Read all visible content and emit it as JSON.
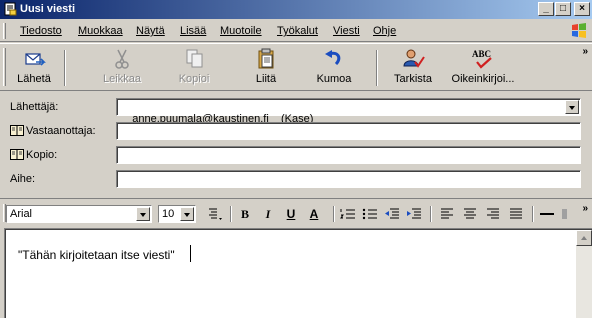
{
  "window": {
    "title": "Uusi viesti",
    "minimize": "_",
    "maximize": "□",
    "close": "×"
  },
  "menu": [
    {
      "label": "Tiedosto"
    },
    {
      "label": "Muokkaa"
    },
    {
      "label": "Näytä"
    },
    {
      "label": "Lisää"
    },
    {
      "label": "Muotoile"
    },
    {
      "label": "Työkalut"
    },
    {
      "label": "Viesti"
    },
    {
      "label": "Ohje"
    }
  ],
  "toolbar": {
    "send": "Lähetä",
    "cut": "Leikkaa",
    "copy": "Kopioi",
    "paste": "Liitä",
    "undo": "Kumoa",
    "check": "Tarkista",
    "spelling": "Oikeinkirjoi...",
    "spelling_icon_text": "ABC",
    "more": "»"
  },
  "headers": {
    "from_label": "Lähettäjä:",
    "from_value": "anne.puumala@kaustinen.fi    (Kase)",
    "to_label": "Vastaanottaja:",
    "to_value": "",
    "cc_label": "Kopio:",
    "cc_value": "",
    "subject_label": "Aihe:",
    "subject_value": ""
  },
  "format": {
    "font": "Arial",
    "size": "10",
    "bold": "B",
    "italic": "I",
    "underline": "U",
    "color": "A",
    "more": "»"
  },
  "message": {
    "body": "\"Tähän kirjoitetaan itse viesti\""
  },
  "colors": {
    "title_start": "#0a246a",
    "title_end": "#a6caf0",
    "face": "#d4d0c8"
  }
}
